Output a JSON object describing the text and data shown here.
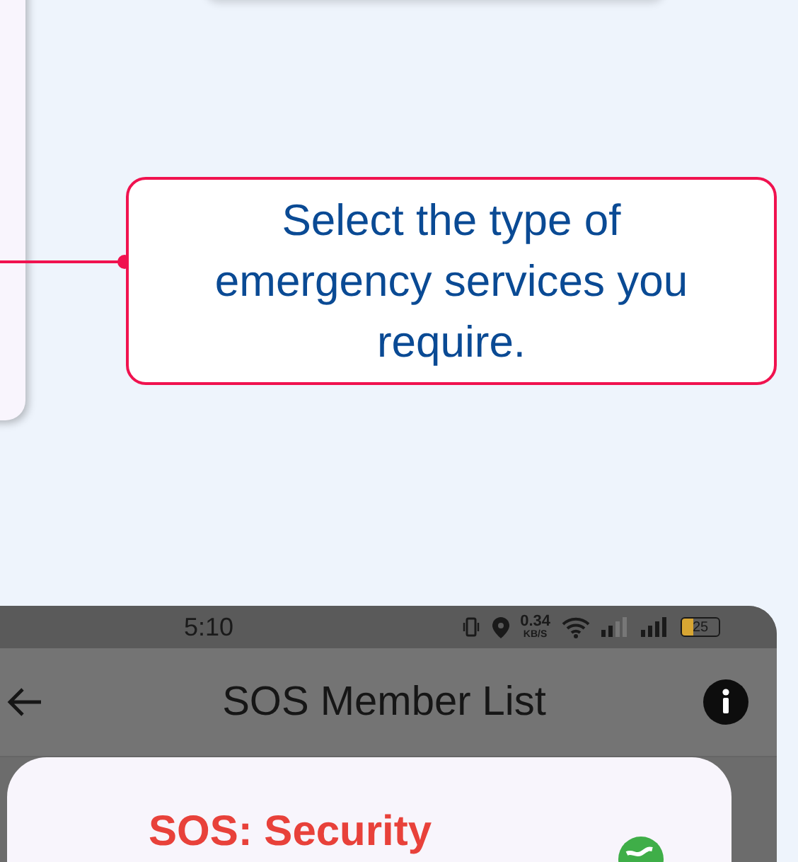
{
  "callout": {
    "text": "Select the type of emergency services you require."
  },
  "phone": {
    "status_bar": {
      "time": "5:10",
      "net_speed": "0.34",
      "net_unit": "KB/S",
      "battery": "25"
    },
    "app_bar": {
      "title": "SOS Member List"
    },
    "dialog": {
      "title": "SOS: Security"
    }
  }
}
